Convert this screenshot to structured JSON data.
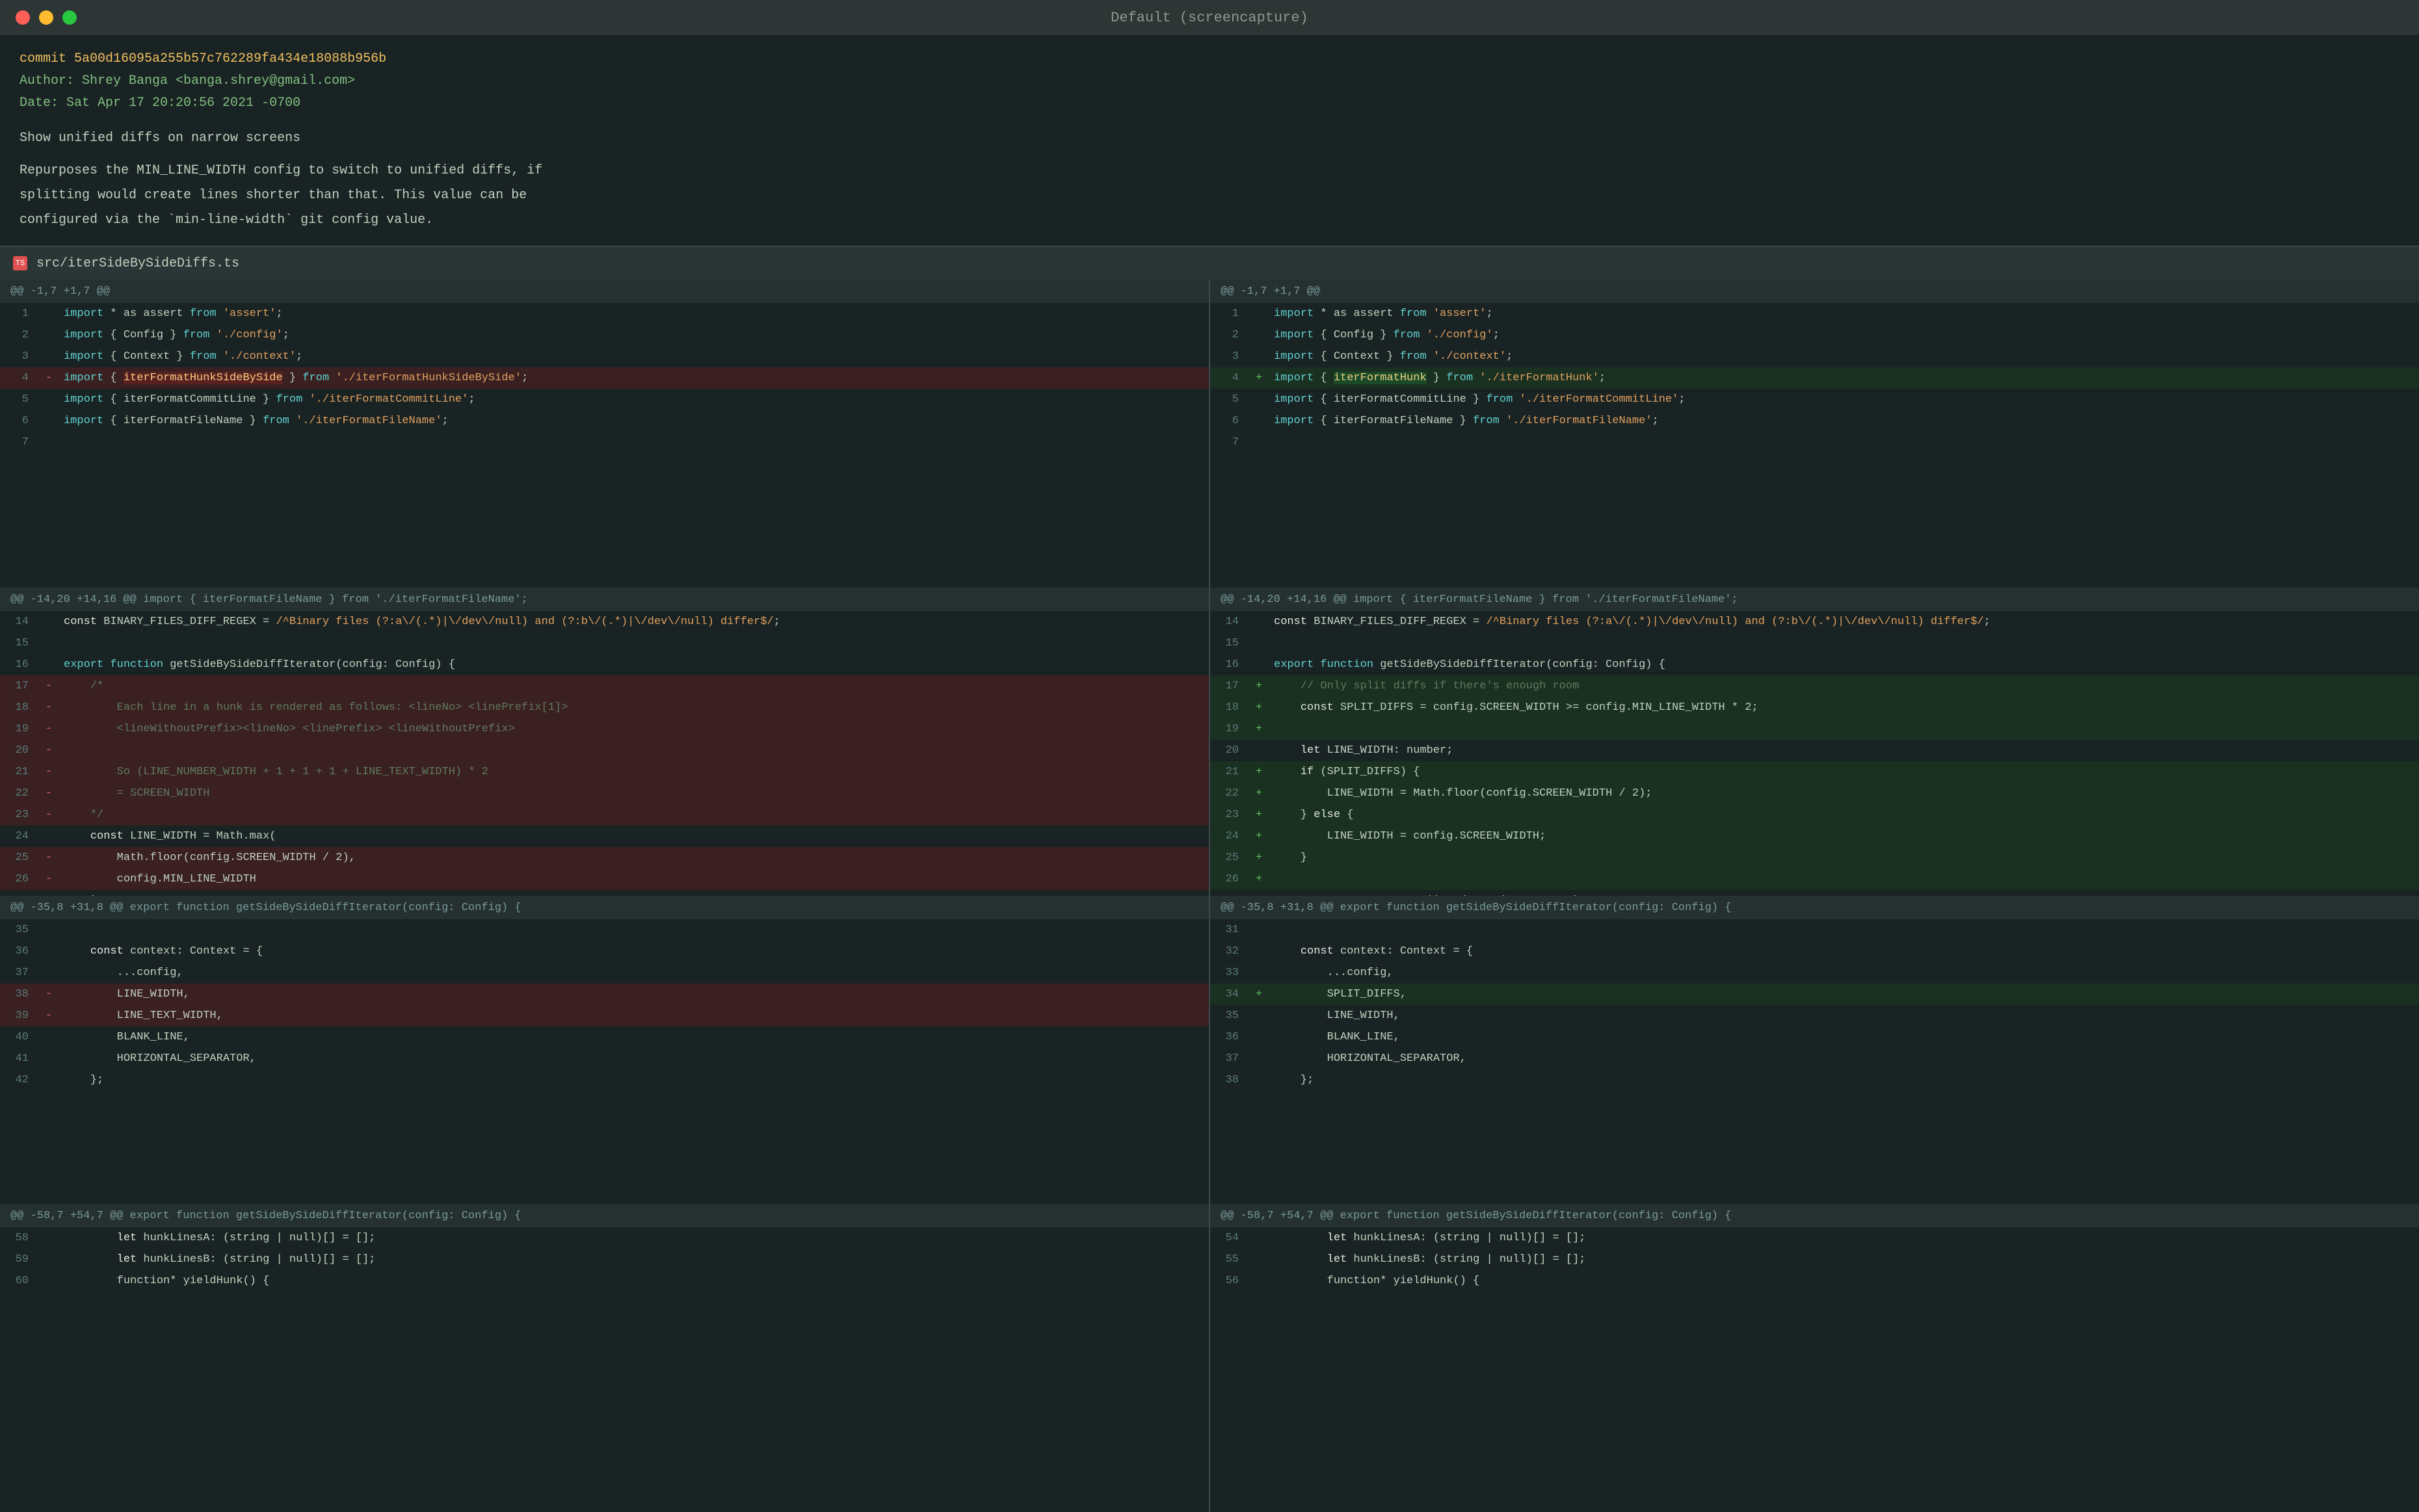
{
  "window": {
    "title": "Default (screencapture)"
  },
  "commit": {
    "hash": "commit 5a00d16095a255b57c762289fa434e18088b956b",
    "author": "Author: Shrey Banga <banga.shrey@gmail.com>",
    "date": "Date:   Sat Apr 17 20:20:56 2021 -0700",
    "message": "Show unified diffs on narrow screens",
    "description": "Repurposes the MIN_LINE_WIDTH config to switch to unified diffs, if\nsplitting would create lines shorter than that. This value can be\nconfigured via the `min-line-width` git config value."
  },
  "file": {
    "name": "src/iterSideBySideDiffs.ts"
  },
  "hunks": {
    "left_hunk1": "@@ -1,7 +1,7 @@",
    "right_hunk1": "@@ -1,7 +1,7 @@",
    "left_hunk2": "@@ -14,20 +14,16 @@ import { iterFormatFileName } from './iterFormatFileName';",
    "right_hunk2": "@@ -14,20 +14,16 @@ import { iterFormatFileName } from './iterFormatFileName';",
    "left_hunk3": "@@ -35,8 +31,8 @@ export function getSideBySideDiffIterator(config: Config) {",
    "right_hunk3": "@@ -35,8 +31,8 @@ export function getSideBySideDiffIterator(config: Config) {",
    "left_hunk4": "@@ -58,7 +54,7 @@ export function getSideBySideDiffIterator(config: Config) {",
    "right_hunk4": "@@ -58,7 +54,7 @@ export function getSideBySideDiffIterator(config: Config) {"
  }
}
